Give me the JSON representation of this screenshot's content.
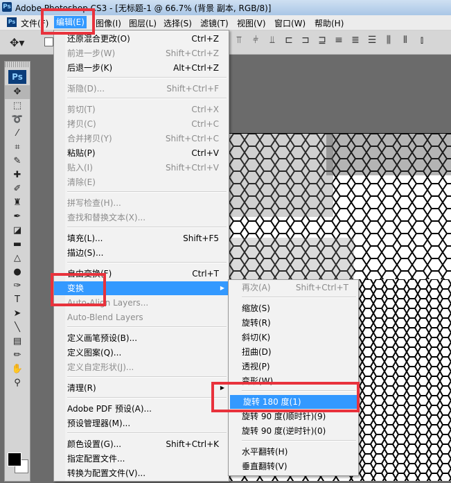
{
  "window": {
    "title": "Adobe Photoshop CS3 - [无标题-1 @ 66.7% (背景 副本, RGB/8)]",
    "app_badge": "Ps"
  },
  "menubar": {
    "items": [
      "文件(F)",
      "编辑(E)",
      "图像(I)",
      "图层(L)",
      "选择(S)",
      "滤镜(T)",
      "视图(V)",
      "窗口(W)",
      "帮助(H)"
    ],
    "active": "编辑(E)"
  },
  "toolbox": {
    "logo": "Ps",
    "tools": [
      "move-tool",
      "marquee-tool",
      "lasso-tool",
      "magic-wand-tool",
      "crop-tool",
      "slice-tool",
      "healing-brush-tool",
      "brush-tool",
      "clone-stamp-tool",
      "history-brush-tool",
      "eraser-tool",
      "gradient-tool",
      "blur-tool",
      "dodge-tool",
      "pen-tool",
      "type-tool",
      "path-selection-tool",
      "line-tool",
      "notes-tool",
      "eyedropper-tool",
      "hand-tool",
      "zoom-tool"
    ],
    "foreground_color": "#000000",
    "background_color": "#ffffff"
  },
  "edit_menu": {
    "items": [
      {
        "label": "还原混合更改(O)",
        "shortcut": "Ctrl+Z",
        "enabled": true
      },
      {
        "label": "前进一步(W)",
        "shortcut": "Shift+Ctrl+Z",
        "enabled": false
      },
      {
        "label": "后退一步(K)",
        "shortcut": "Alt+Ctrl+Z",
        "enabled": true
      },
      {
        "label": "渐隐(D)...",
        "shortcut": "Shift+Ctrl+F",
        "enabled": false
      },
      {
        "label": "剪切(T)",
        "shortcut": "Ctrl+X",
        "enabled": false
      },
      {
        "label": "拷贝(C)",
        "shortcut": "Ctrl+C",
        "enabled": false
      },
      {
        "label": "合并拷贝(Y)",
        "shortcut": "Shift+Ctrl+C",
        "enabled": false
      },
      {
        "label": "粘贴(P)",
        "shortcut": "Ctrl+V",
        "enabled": true
      },
      {
        "label": "贴入(I)",
        "shortcut": "Shift+Ctrl+V",
        "enabled": false
      },
      {
        "label": "清除(E)",
        "shortcut": "",
        "enabled": false
      },
      {
        "label": "拼写检查(H)...",
        "shortcut": "",
        "enabled": false
      },
      {
        "label": "查找和替换文本(X)...",
        "shortcut": "",
        "enabled": false
      },
      {
        "label": "填充(L)...",
        "shortcut": "Shift+F5",
        "enabled": true
      },
      {
        "label": "描边(S)...",
        "shortcut": "",
        "enabled": true
      },
      {
        "label": "自由变换(F)",
        "shortcut": "Ctrl+T",
        "enabled": true
      },
      {
        "label": "变换",
        "shortcut": "",
        "enabled": true,
        "highlighted": true
      },
      {
        "label": "Auto-Align Layers...",
        "shortcut": "",
        "enabled": false
      },
      {
        "label": "Auto-Blend Layers",
        "shortcut": "",
        "enabled": false
      },
      {
        "label": "定义画笔预设(B)...",
        "shortcut": "",
        "enabled": true
      },
      {
        "label": "定义图案(Q)...",
        "shortcut": "",
        "enabled": true
      },
      {
        "label": "定义自定形状(J)...",
        "shortcut": "",
        "enabled": false
      },
      {
        "label": "清理(R)",
        "shortcut": "",
        "enabled": true
      },
      {
        "label": "Adobe PDF 预设(A)...",
        "shortcut": "",
        "enabled": true
      },
      {
        "label": "预设管理器(M)...",
        "shortcut": "",
        "enabled": true
      },
      {
        "label": "颜色设置(G)...",
        "shortcut": "Shift+Ctrl+K",
        "enabled": true
      },
      {
        "label": "指定配置文件...",
        "shortcut": "",
        "enabled": true
      },
      {
        "label": "转换为配置文件(V)...",
        "shortcut": "",
        "enabled": true
      }
    ]
  },
  "transform_submenu": {
    "items": [
      {
        "label": "再次(A)",
        "shortcut": "Shift+Ctrl+T",
        "enabled": false
      },
      {
        "label": "缩放(S)",
        "enabled": true
      },
      {
        "label": "旋转(R)",
        "enabled": true
      },
      {
        "label": "斜切(K)",
        "enabled": true
      },
      {
        "label": "扭曲(D)",
        "enabled": true
      },
      {
        "label": "透视(P)",
        "enabled": true
      },
      {
        "label": "变形(W)",
        "enabled": true
      },
      {
        "label": "旋转 180 度(1)",
        "enabled": true,
        "highlighted": true
      },
      {
        "label": "旋转 90 度(顺时针)(9)",
        "enabled": true
      },
      {
        "label": "旋转 90 度(逆时针)(0)",
        "enabled": true
      },
      {
        "label": "水平翻转(H)",
        "enabled": true
      },
      {
        "label": "垂直翻转(V)",
        "enabled": true
      }
    ]
  },
  "colors": {
    "highlight": "#3399ff",
    "annotation_red": "#e8323c"
  }
}
